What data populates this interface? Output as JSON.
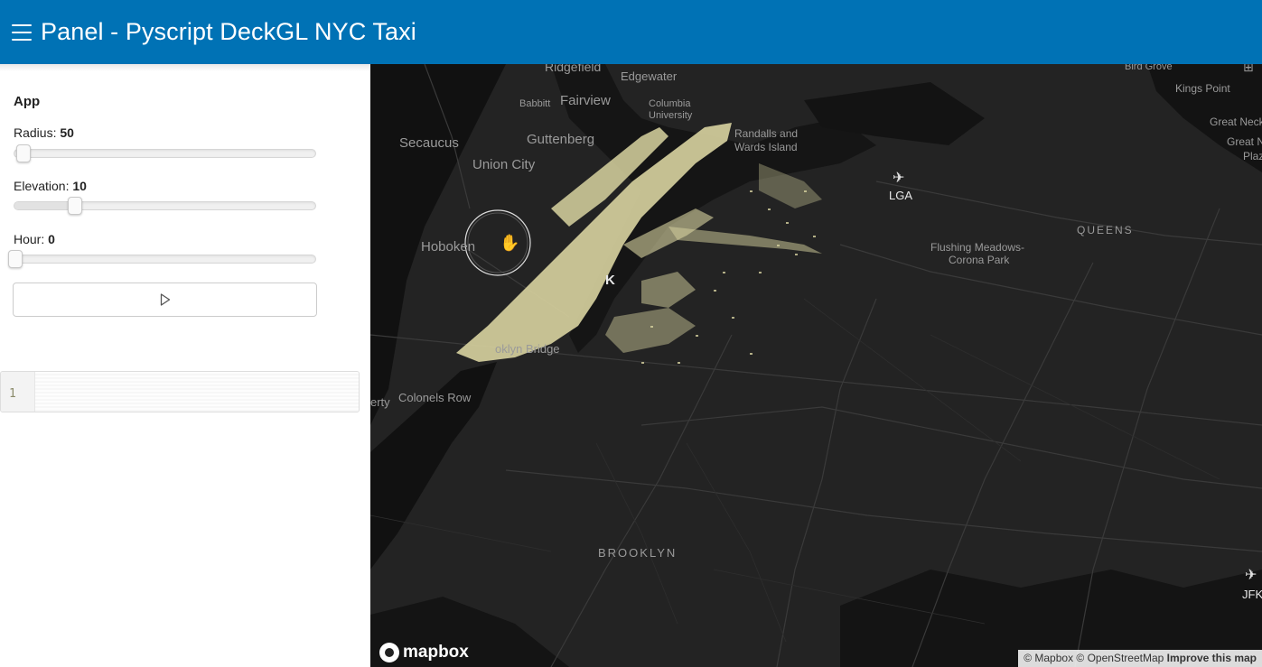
{
  "header": {
    "title": "Panel - Pyscript DeckGL NYC Taxi"
  },
  "sidebar": {
    "app_title": "App",
    "radius": {
      "label": "Radius: ",
      "value": "50",
      "fraction": 0.03
    },
    "elevation": {
      "label": "Elevation: ",
      "value": "10",
      "fraction": 0.2
    },
    "hour": {
      "label": "Hour: ",
      "value": "0",
      "fraction": 0.0
    },
    "play_icon": "play-icon"
  },
  "editor": {
    "line_number": "1"
  },
  "map": {
    "places": {
      "ridgefield": "Ridgefield",
      "edgewater": "Edgewater",
      "babbitt": "Babbitt",
      "fairview": "Fairview",
      "columbia": "Columbia",
      "university": "University",
      "secaucus": "Secaucus",
      "guttenberg": "Guttenberg",
      "union_city": "Union City",
      "randalls": "Randalls and",
      "wards": "Wards Island",
      "lga": "LGA",
      "hoboken": "Hoboken",
      "queens": "QUEENS",
      "flushing1": "Flushing Meadows-",
      "flushing2": "Corona Park",
      "k": "K",
      "bridge": "oklyn Bridge",
      "erty": "erty",
      "colonels": "Colonels Row",
      "brooklyn": "BROOKLYN",
      "bird_grove": "Bird Grove",
      "kings_point": "Kings Point",
      "great_neck": "Great Neck",
      "great_neck2": "Great N",
      "plaz": "Plaz",
      "jfk": "JFK"
    },
    "logo": "mapbox",
    "attribution": {
      "text": "© Mapbox © OpenStreetMap ",
      "improve": "Improve this map"
    }
  },
  "colors": {
    "header": "#0072b5",
    "map_bg": "#232323",
    "taxi_points": "#d8d3a0"
  }
}
